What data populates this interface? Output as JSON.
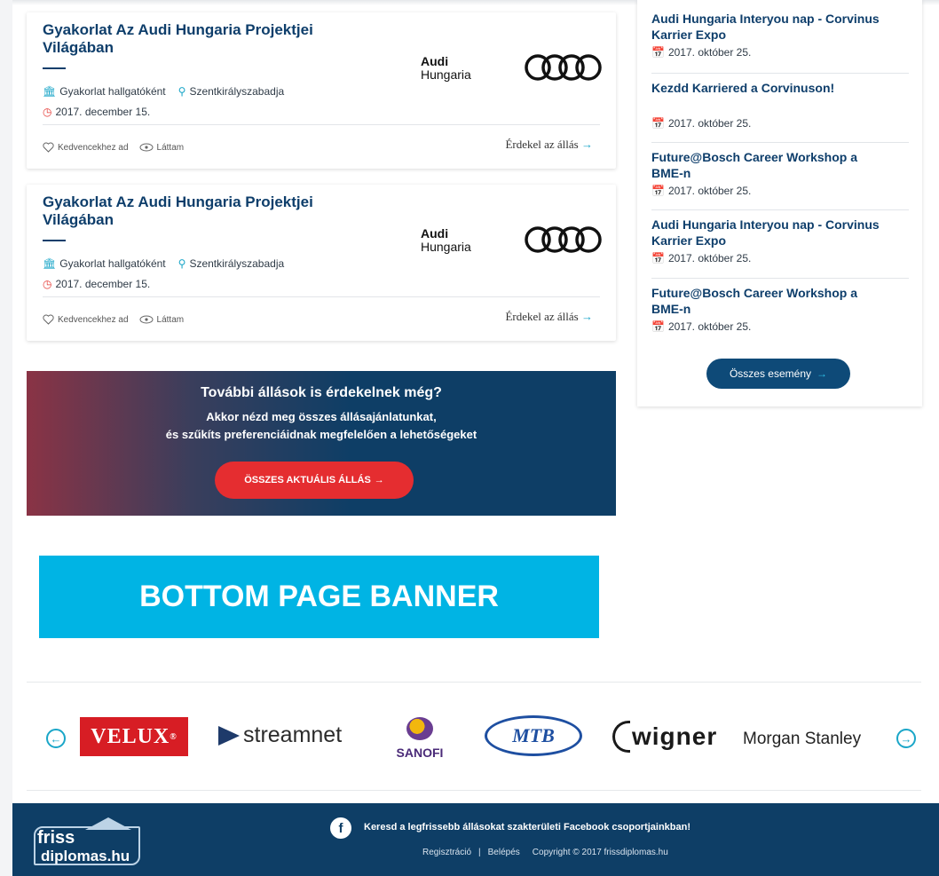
{
  "jobs": [
    {
      "title": "Gyakorlat Az Audi Hungaria Projektjei Világában",
      "company_brand": "Audi",
      "company_sub": "Hungaria",
      "type": "Gyakorlat hallgatóként",
      "location": "Szentkirályszabadja",
      "date": "2017. december 15.",
      "favorite_label": "Kedvencekhez ad",
      "seen_label": "Láttam",
      "interest_label": "Érdekel az állás"
    },
    {
      "title": "Gyakorlat Az Audi Hungaria Projektjei Világában",
      "company_brand": "Audi",
      "company_sub": "Hungaria",
      "type": "Gyakorlat hallgatóként",
      "location": "Szentkirályszabadja",
      "date": "2017. december 15.",
      "favorite_label": "Kedvencekhez ad",
      "seen_label": "Láttam",
      "interest_label": "Érdekel az állás"
    }
  ],
  "events": {
    "items": [
      {
        "title": "Audi Hungaria Interyou nap - Corvinus Karrier Expo",
        "date": "2017. október 25."
      },
      {
        "title": "Kezdd Karriered a Corvinuson!",
        "date": "2017. október 25."
      },
      {
        "title": "Future@Bosch Career Workshop a BME-n",
        "date": "2017. október 25."
      },
      {
        "title": "Audi Hungaria Interyou nap - Corvinus Karrier Expo",
        "date": "2017. október 25."
      },
      {
        "title": "Future@Bosch Career Workshop a BME-n",
        "date": "2017. október 25."
      }
    ],
    "all_button": "Összes esemény"
  },
  "promo": {
    "title": "További állások is érdekelnek még?",
    "line1": "Akkor nézd meg összes állásajánlatunkat,",
    "line2": "és szűkíts preferenciáidnak megfelelően a lehetőségeket",
    "button": "ÖSSZES AKTUÁLIS ÁLLÁS"
  },
  "bottom_banner": "BOTTOM PAGE BANNER",
  "partners": {
    "velux": "VELUX",
    "velux_mark": "®",
    "streamnet_a": "stream",
    "streamnet_b": "net",
    "sanofi": "SANOFI",
    "mtb": "MTB",
    "wigner": "wigner",
    "morgan": "Morgan Stanley"
  },
  "footer": {
    "logo_line1": "friss",
    "logo_line2": "diplomas.hu",
    "facebook_text": "Keresd a legfrissebb állásokat szakterületi Facebook csoportjainkban!",
    "link_register": "Regisztráció",
    "sep": "|",
    "link_login": "Belépés",
    "copyright": "Copyright © 2017 frissdiplomas.hu"
  },
  "colors": {
    "brand_navy": "#0e3e66",
    "accent_cyan": "#1aa6c8",
    "date_red": "#e53935",
    "promo_button": "#e52d30",
    "banner_blue": "#00b4e4"
  }
}
